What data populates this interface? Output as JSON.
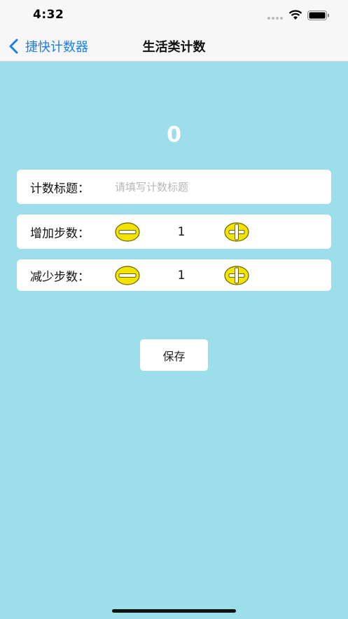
{
  "status_bar": {
    "time": "4:32"
  },
  "nav": {
    "back_label": "捷快计数器",
    "title": "生活类计数"
  },
  "counter": {
    "value": "0"
  },
  "title_field": {
    "label": "计数标题：",
    "placeholder": "请填写计数标题",
    "value": ""
  },
  "increase_step": {
    "label": "增加步数：",
    "value": "1"
  },
  "decrease_step": {
    "label": "减少步数：",
    "value": "1"
  },
  "save_label": "保存",
  "colors": {
    "background": "#9cdeea",
    "accent": "#1a7fe8",
    "coin": "#f2e300"
  }
}
